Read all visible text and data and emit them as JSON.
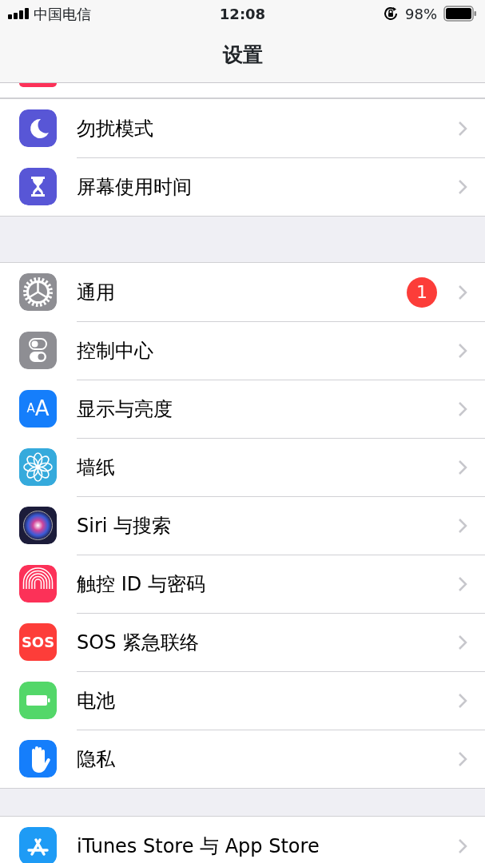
{
  "status_bar": {
    "carrier": "中国电信",
    "time": "12:08",
    "battery": "98%"
  },
  "nav": {
    "title": "设置"
  },
  "groups": [
    {
      "rows": [
        {
          "label": "勿扰模式",
          "kind": "moon"
        },
        {
          "label": "屏幕使用时间",
          "kind": "hourglass"
        }
      ]
    },
    {
      "rows": [
        {
          "label": "通用",
          "kind": "gear",
          "badge": "1"
        },
        {
          "label": "控制中心",
          "kind": "toggles"
        },
        {
          "label": "显示与亮度",
          "kind": "textsize",
          "icon_text": "AA"
        },
        {
          "label": "墙纸",
          "kind": "flower"
        },
        {
          "label": "Siri 与搜索",
          "kind": "orb"
        },
        {
          "label": "触控 ID 与密码",
          "kind": "fingerprint"
        },
        {
          "label": "SOS 紧急联络",
          "kind": "sos",
          "icon_text": "SOS"
        },
        {
          "label": "电池",
          "kind": "battery"
        },
        {
          "label": "隐私",
          "kind": "hand"
        }
      ]
    },
    {
      "rows": [
        {
          "label": "iTunes Store 与 App Store",
          "kind": "appstore"
        }
      ]
    }
  ]
}
